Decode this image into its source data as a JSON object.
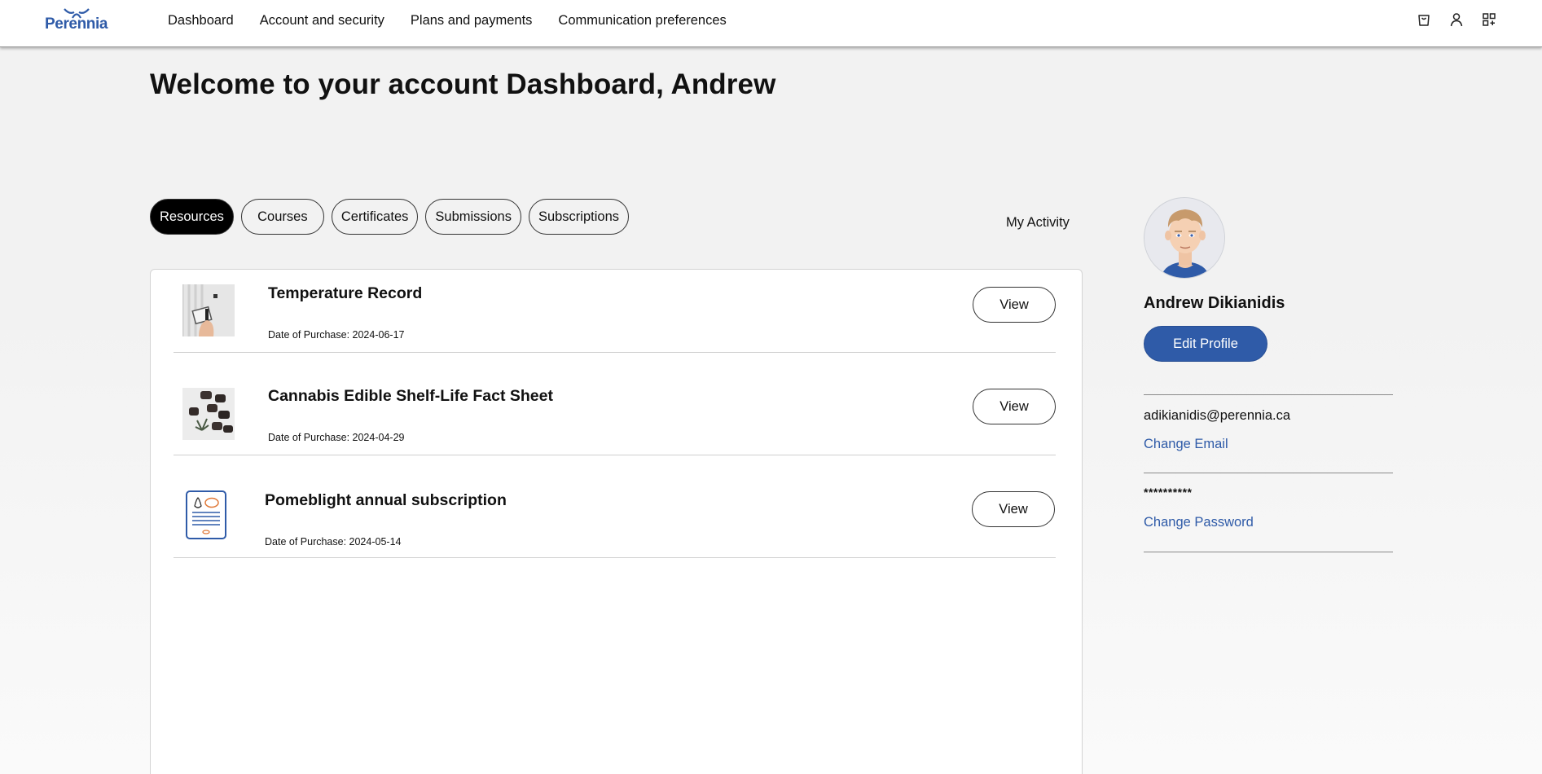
{
  "header": {
    "logo_text": "Perennia",
    "nav": [
      "Dashboard",
      "Account and security",
      "Plans and payments",
      "Communication preferences"
    ],
    "icons": [
      "cart-icon",
      "user-icon",
      "apps-grid-icon"
    ]
  },
  "page": {
    "welcome": "Welcome to your account Dashboard, Andrew"
  },
  "tabs": [
    "Resources",
    "Courses",
    "Certificates",
    "Submissions",
    "Subscriptions"
  ],
  "active_tab": "Resources",
  "my_activity": "My Activity",
  "resources": [
    {
      "title": "Temperature Record",
      "date": "Date of Purchase: 2024-06-17",
      "action": "View"
    },
    {
      "title": "Cannabis Edible Shelf-Life Fact Sheet",
      "date": "Date of Purchase: 2024-04-29",
      "action": "View"
    },
    {
      "title": "Pomeblight annual subscription",
      "date": "Date of Purchase: 2024-05-14",
      "action": "View"
    }
  ],
  "profile": {
    "name": "Andrew Dikianidis",
    "edit_label": "Edit Profile",
    "email": "adikianidis@perennia.ca",
    "change_email": "Change Email",
    "password_mask": "**********",
    "change_password": "Change Password"
  },
  "colors": {
    "brand_blue": "#2f5ba8",
    "active_tab_bg": "#000000",
    "page_bg": "#f2f2f2"
  }
}
